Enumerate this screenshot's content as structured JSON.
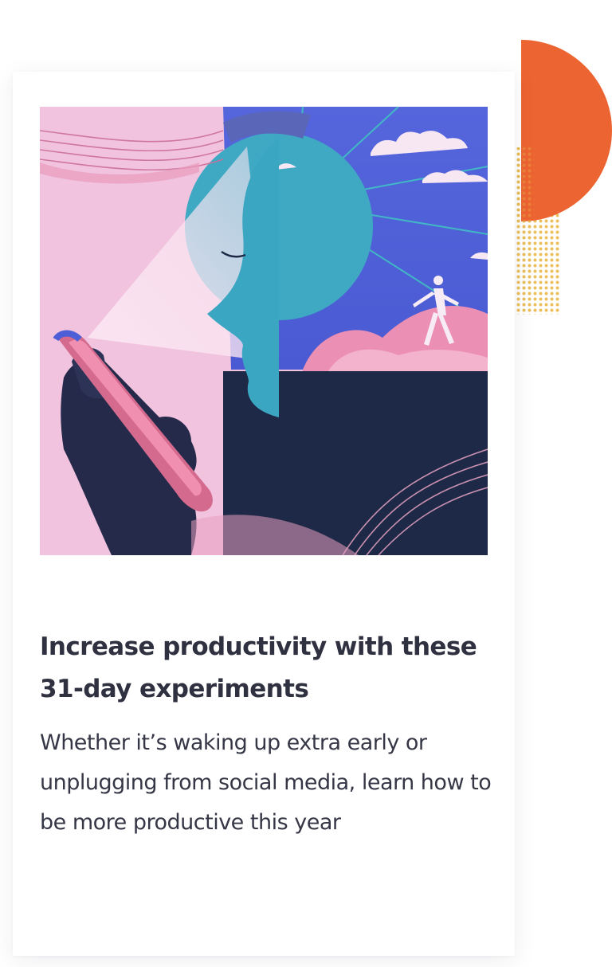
{
  "article_card": {
    "image_alt": "Illustration of a person in profile looking at a phone, with a sun, clouds and a running figure",
    "title": "Increase productivity with these 31-day experiments",
    "description": "Whether it’s waking up extra early or unplugging from social media, learn how to be more productive this year"
  },
  "colors": {
    "title_text": "#2f3040",
    "body_text": "#363746",
    "card_background": "#ffffff",
    "accent_orange": "#ec6431",
    "accent_mustard": "#e8b84a",
    "illustration_pink": "#f1c3de",
    "illustration_blue": "#4c5fd6",
    "illustration_teal": "#3fa9c4",
    "illustration_navy": "#1d2946"
  }
}
